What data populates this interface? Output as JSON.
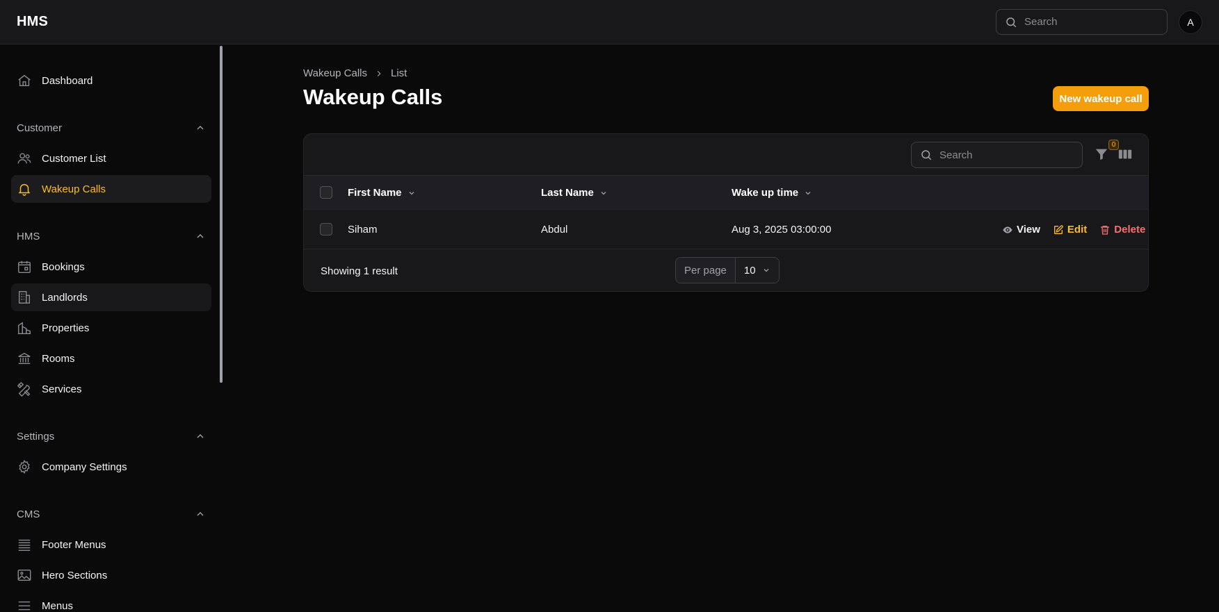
{
  "app": {
    "brand": "HMS"
  },
  "topbar": {
    "search_placeholder": "Search",
    "avatar_initial": "A"
  },
  "sidebar": {
    "dashboard": "Dashboard",
    "groups": [
      {
        "label": "Customer",
        "items": [
          "Customer List",
          "Wakeup Calls"
        ]
      },
      {
        "label": "HMS",
        "items": [
          "Bookings",
          "Landlords",
          "Properties",
          "Rooms",
          "Services"
        ]
      },
      {
        "label": "Settings",
        "items": [
          "Company Settings"
        ]
      },
      {
        "label": "CMS",
        "items": [
          "Footer Menus",
          "Hero Sections",
          "Menus"
        ]
      }
    ],
    "active_item": "Wakeup Calls"
  },
  "breadcrumb": {
    "parent": "Wakeup Calls",
    "current": "List"
  },
  "page": {
    "title": "Wakeup Calls",
    "new_button": "New wakeup call"
  },
  "table": {
    "search_placeholder": "Search",
    "filter_count": "0",
    "columns": [
      "First Name",
      "Last Name",
      "Wake up time"
    ],
    "rows": [
      {
        "first_name": "Siham",
        "last_name": "Abdul",
        "wake_up_time": "Aug 3, 2025 03:00:00"
      }
    ],
    "actions": {
      "view": "View",
      "edit": "Edit",
      "delete": "Delete"
    },
    "footer": {
      "showing": "Showing 1 result",
      "per_page_label": "Per page",
      "per_page_value": "10"
    }
  },
  "colors": {
    "accent": "#f59e0b",
    "danger": "#f87171",
    "active_nav": "#fbbf24"
  }
}
